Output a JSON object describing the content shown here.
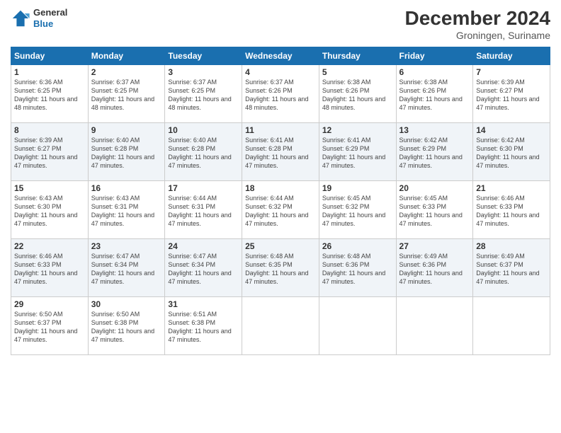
{
  "header": {
    "logo": {
      "general": "General",
      "blue": "Blue"
    },
    "title": "December 2024",
    "subtitle": "Groningen, Suriname"
  },
  "calendar": {
    "days": [
      "Sunday",
      "Monday",
      "Tuesday",
      "Wednesday",
      "Thursday",
      "Friday",
      "Saturday"
    ],
    "weeks": [
      [
        {
          "day": 1,
          "sunrise": "6:36 AM",
          "sunset": "6:25 PM",
          "daylight": "11 hours and 48 minutes."
        },
        {
          "day": 2,
          "sunrise": "6:37 AM",
          "sunset": "6:25 PM",
          "daylight": "11 hours and 48 minutes."
        },
        {
          "day": 3,
          "sunrise": "6:37 AM",
          "sunset": "6:25 PM",
          "daylight": "11 hours and 48 minutes."
        },
        {
          "day": 4,
          "sunrise": "6:37 AM",
          "sunset": "6:26 PM",
          "daylight": "11 hours and 48 minutes."
        },
        {
          "day": 5,
          "sunrise": "6:38 AM",
          "sunset": "6:26 PM",
          "daylight": "11 hours and 48 minutes."
        },
        {
          "day": 6,
          "sunrise": "6:38 AM",
          "sunset": "6:26 PM",
          "daylight": "11 hours and 47 minutes."
        },
        {
          "day": 7,
          "sunrise": "6:39 AM",
          "sunset": "6:27 PM",
          "daylight": "11 hours and 47 minutes."
        }
      ],
      [
        {
          "day": 8,
          "sunrise": "6:39 AM",
          "sunset": "6:27 PM",
          "daylight": "11 hours and 47 minutes."
        },
        {
          "day": 9,
          "sunrise": "6:40 AM",
          "sunset": "6:28 PM",
          "daylight": "11 hours and 47 minutes."
        },
        {
          "day": 10,
          "sunrise": "6:40 AM",
          "sunset": "6:28 PM",
          "daylight": "11 hours and 47 minutes."
        },
        {
          "day": 11,
          "sunrise": "6:41 AM",
          "sunset": "6:28 PM",
          "daylight": "11 hours and 47 minutes."
        },
        {
          "day": 12,
          "sunrise": "6:41 AM",
          "sunset": "6:29 PM",
          "daylight": "11 hours and 47 minutes."
        },
        {
          "day": 13,
          "sunrise": "6:42 AM",
          "sunset": "6:29 PM",
          "daylight": "11 hours and 47 minutes."
        },
        {
          "day": 14,
          "sunrise": "6:42 AM",
          "sunset": "6:30 PM",
          "daylight": "11 hours and 47 minutes."
        }
      ],
      [
        {
          "day": 15,
          "sunrise": "6:43 AM",
          "sunset": "6:30 PM",
          "daylight": "11 hours and 47 minutes."
        },
        {
          "day": 16,
          "sunrise": "6:43 AM",
          "sunset": "6:31 PM",
          "daylight": "11 hours and 47 minutes."
        },
        {
          "day": 17,
          "sunrise": "6:44 AM",
          "sunset": "6:31 PM",
          "daylight": "11 hours and 47 minutes."
        },
        {
          "day": 18,
          "sunrise": "6:44 AM",
          "sunset": "6:32 PM",
          "daylight": "11 hours and 47 minutes."
        },
        {
          "day": 19,
          "sunrise": "6:45 AM",
          "sunset": "6:32 PM",
          "daylight": "11 hours and 47 minutes."
        },
        {
          "day": 20,
          "sunrise": "6:45 AM",
          "sunset": "6:33 PM",
          "daylight": "11 hours and 47 minutes."
        },
        {
          "day": 21,
          "sunrise": "6:46 AM",
          "sunset": "6:33 PM",
          "daylight": "11 hours and 47 minutes."
        }
      ],
      [
        {
          "day": 22,
          "sunrise": "6:46 AM",
          "sunset": "6:33 PM",
          "daylight": "11 hours and 47 minutes."
        },
        {
          "day": 23,
          "sunrise": "6:47 AM",
          "sunset": "6:34 PM",
          "daylight": "11 hours and 47 minutes."
        },
        {
          "day": 24,
          "sunrise": "6:47 AM",
          "sunset": "6:34 PM",
          "daylight": "11 hours and 47 minutes."
        },
        {
          "day": 25,
          "sunrise": "6:48 AM",
          "sunset": "6:35 PM",
          "daylight": "11 hours and 47 minutes."
        },
        {
          "day": 26,
          "sunrise": "6:48 AM",
          "sunset": "6:36 PM",
          "daylight": "11 hours and 47 minutes."
        },
        {
          "day": 27,
          "sunrise": "6:49 AM",
          "sunset": "6:36 PM",
          "daylight": "11 hours and 47 minutes."
        },
        {
          "day": 28,
          "sunrise": "6:49 AM",
          "sunset": "6:37 PM",
          "daylight": "11 hours and 47 minutes."
        }
      ],
      [
        {
          "day": 29,
          "sunrise": "6:50 AM",
          "sunset": "6:37 PM",
          "daylight": "11 hours and 47 minutes."
        },
        {
          "day": 30,
          "sunrise": "6:50 AM",
          "sunset": "6:38 PM",
          "daylight": "11 hours and 47 minutes."
        },
        {
          "day": 31,
          "sunrise": "6:51 AM",
          "sunset": "6:38 PM",
          "daylight": "11 hours and 47 minutes."
        },
        null,
        null,
        null,
        null
      ]
    ]
  }
}
